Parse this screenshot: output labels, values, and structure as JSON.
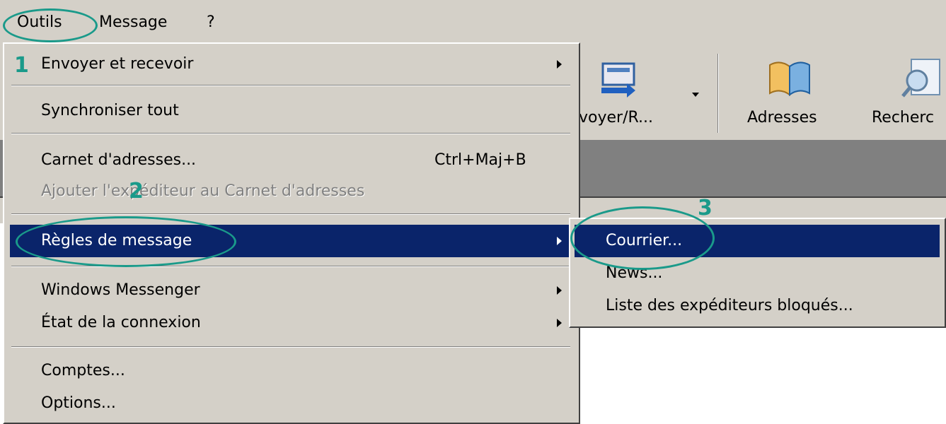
{
  "menubar": {
    "items": [
      "Outils",
      "Message",
      "?"
    ]
  },
  "toolbar": {
    "buttons": [
      {
        "label": "voyer/R...",
        "icon": "send-receive-icon"
      },
      {
        "label": "Adresses",
        "icon": "address-book-icon"
      },
      {
        "label": "Recherc",
        "icon": "find-icon"
      }
    ]
  },
  "menu": {
    "send_receive": "Envoyer et recevoir",
    "sync_all": "Synchroniser tout",
    "address_book": "Carnet d'adresses...",
    "address_book_shortcut": "Ctrl+Maj+B",
    "add_sender": "Ajouter l'expéditeur au Carnet d'adresses",
    "message_rules": "Règles de message",
    "windows_messenger": "Windows Messenger",
    "connection_state": "État de la connexion",
    "accounts": "Comptes...",
    "options": "Options..."
  },
  "submenu": {
    "mail": "Courrier...",
    "news": "News...",
    "blocked_senders": "Liste des expéditeurs bloqués..."
  },
  "annotations": {
    "step1": "1",
    "step2": "2",
    "step3": "3",
    "color": "#1a9a8a"
  },
  "colors": {
    "highlight": "#0a246a",
    "menu_bg": "#d4d0c8"
  }
}
